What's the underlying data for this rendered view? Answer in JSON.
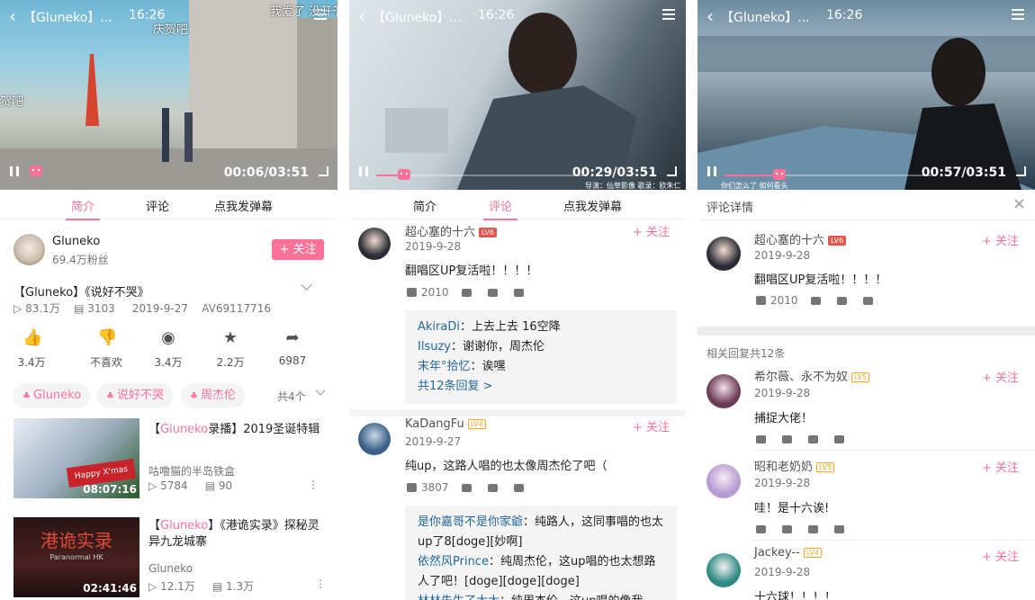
{
  "common": {
    "video_title": "【Gluneko】...",
    "tab_intro": "简介",
    "tab_comment": "评论",
    "tab_danmu": "点我发弹幕",
    "follow": "+ 关注"
  },
  "p1": {
    "clock": "16:26",
    "time": "00:06/03:51",
    "danmu": [
      "我爱了 没开爷",
      "庆贺吧",
      "贺吧"
    ],
    "up_name": "Gluneko",
    "fans": "69.4万粉丝",
    "follow_btn": "+ 关注",
    "title": "【Gluneko】《说好不哭》",
    "views": "83.1万",
    "danmaku": "3103",
    "date": "2019-9-27",
    "av": "AV69117716",
    "actions": [
      {
        "icon": "like-icon",
        "label": "3.4万"
      },
      {
        "icon": "dislike-icon",
        "label": "不喜欢"
      },
      {
        "icon": "coin-icon",
        "label": "3.4万"
      },
      {
        "icon": "star-icon",
        "label": "2.2万"
      },
      {
        "icon": "share-icon",
        "label": "6987"
      }
    ],
    "tags": [
      "Gluneko",
      "说好不哭",
      "周杰伦"
    ],
    "tag_count": "共4个",
    "related": [
      {
        "title_hl": "Gluneko",
        "title_rest": "录播】2019圣诞特辑",
        "title_pre": "【",
        "author": "咕噜猫的半岛铁盒",
        "views": "5784",
        "dm": "90",
        "duration": "08:07:16",
        "thumb_text": "Happy X'mas"
      },
      {
        "title_hl": "Gluneko",
        "title_rest": "】《港诡实录》探秘灵异九龙城寨",
        "title_pre": "【",
        "author": "Gluneko",
        "views": "12.1万",
        "dm": "1.3万",
        "duration": "02:41:46",
        "thumb_text": "港诡实录",
        "thumb_sub": "Paranormal HK"
      }
    ]
  },
  "p2": {
    "clock": "16:26",
    "time": "00:29/03:51",
    "sub": "导演：仙草影像  歌录：欧朱仁",
    "comments": [
      {
        "user": "超心塞的十六",
        "level": "LV6",
        "date": "2019-9-28",
        "text": "翻唱区UP复活啦！！！！",
        "likes": "2010",
        "replies": [
          {
            "u": "AkiraDi",
            "t": "上去上去 16空降"
          },
          {
            "u": "Ilsuzy",
            "t": "谢谢你，周杰伦"
          },
          {
            "u": "末年°拾忆",
            "t": "诶嘿"
          }
        ],
        "more": "共12条回复 >"
      },
      {
        "user": "KaDangFu",
        "level": "LV4",
        "date": "2019-9-27",
        "text": "纯up，这路人唱的也太像周杰伦了吧（",
        "likes": "3807",
        "replies": [
          {
            "u": "是你嘉哥不是你家爺",
            "t": "纯路人，这同事唱的也太up了8[doge][妙啊]"
          },
          {
            "u": "依然风Prince",
            "t": "纯周杰伦，这up唱的也太想路人了吧！[doge][doge][doge]"
          },
          {
            "u": "林林先生了太太",
            "t": "纯周杰伦，这up唱的像我"
          }
        ]
      }
    ]
  },
  "p3": {
    "clock": "16:26",
    "time": "00:57/03:51",
    "sub": "你们怎么了  如何看头",
    "header": "评论详情",
    "main": {
      "user": "超心塞的十六",
      "level": "LV6",
      "date": "2019-9-28",
      "text": "翻唱区UP复活啦！！！！",
      "likes": "2010"
    },
    "replies_title": "相关回复共12条",
    "replies": [
      {
        "user": "希尔薇、永不为奴",
        "level": "LV5",
        "date": "2019-9-28",
        "text": "捕捉大佬！"
      },
      {
        "user": "昭和老奶奶",
        "level": "LV5",
        "date": "2019-9-28",
        "text": "哇！是十六诶!"
      },
      {
        "user": "Jackey--",
        "level": "LV4",
        "date": "2019-9-28",
        "text": "十六球！！！！"
      }
    ]
  }
}
